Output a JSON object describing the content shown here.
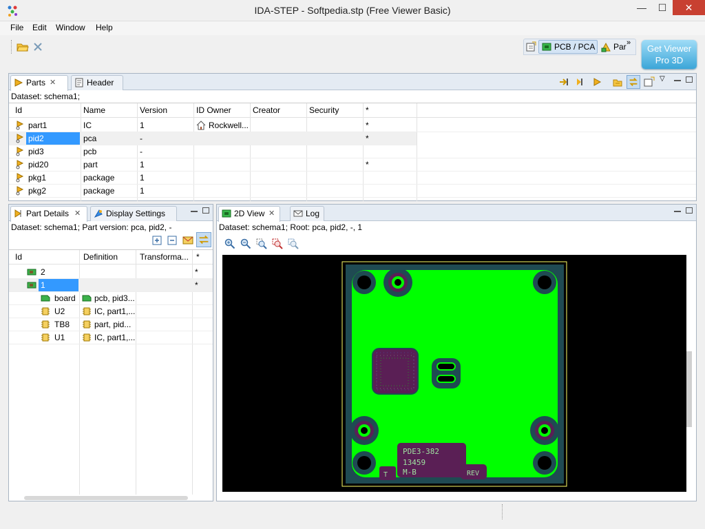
{
  "window": {
    "title": "IDA-STEP - Softpedia.stp (Free Viewer Basic)",
    "minimize": "—",
    "maximize": "☐",
    "close": "✕"
  },
  "menu": [
    "File",
    "Edit",
    "Window",
    "Help"
  ],
  "perspective": {
    "active_label": "PCB / PCA",
    "next_label": "Par",
    "overflow": "»",
    "get_viewer_line1": "Get Viewer",
    "get_viewer_line2": "Pro 3D"
  },
  "parts_panel": {
    "tabs": [
      "Parts",
      "Header"
    ],
    "dataset": "Dataset: schema1;",
    "columns": [
      "Id",
      "Name",
      "Version",
      "ID Owner",
      "Creator",
      "Security",
      "*"
    ],
    "rows": [
      {
        "id": "part1",
        "name": "IC",
        "version": "1",
        "owner": "Rockwell...",
        "creator": "",
        "security": "",
        "star": "*"
      },
      {
        "id": "pid2",
        "name": "pca",
        "version": "-",
        "owner": "",
        "creator": "",
        "security": "",
        "star": "*"
      },
      {
        "id": "pid3",
        "name": "pcb",
        "version": "-",
        "owner": "",
        "creator": "",
        "security": "",
        "star": ""
      },
      {
        "id": "pid20",
        "name": "part",
        "version": "1",
        "owner": "",
        "creator": "",
        "security": "",
        "star": "*"
      },
      {
        "id": "pkg1",
        "name": "package",
        "version": "1",
        "owner": "",
        "creator": "",
        "security": "",
        "star": ""
      },
      {
        "id": "pkg2",
        "name": "package",
        "version": "1",
        "owner": "",
        "creator": "",
        "security": "",
        "star": ""
      }
    ]
  },
  "details_panel": {
    "tabs": [
      "Part Details",
      "Display Settings"
    ],
    "dataset": "Dataset: schema1; Part version: pca, pid2, -",
    "columns": [
      "Id",
      "Definition",
      "Transforma...",
      "*"
    ],
    "rows": [
      {
        "id": "2",
        "definition": "",
        "star": "*"
      },
      {
        "id": "1",
        "definition": "",
        "star": "*"
      },
      {
        "id": "board",
        "definition": "pcb, pid3...",
        "star": ""
      },
      {
        "id": "U2",
        "definition": "IC, part1,...",
        "star": ""
      },
      {
        "id": "TB8",
        "definition": "part, pid...",
        "star": ""
      },
      {
        "id": "U1",
        "definition": "IC, part1,...",
        "star": ""
      }
    ]
  },
  "view_panel": {
    "tabs": [
      "2D View",
      "Log"
    ],
    "dataset": "Dataset: schema1; Root: pca, pid2, -, 1",
    "silkscreen": [
      "PDE3-382",
      "13459",
      "M-B",
      "REV",
      "T"
    ]
  },
  "colors": {
    "board_copper": "#00ff00",
    "board_mask": "#1f4a52",
    "pad_purple": "#5a1f55",
    "outline_yellow": "#ffff66",
    "selection": "#3399ff"
  }
}
